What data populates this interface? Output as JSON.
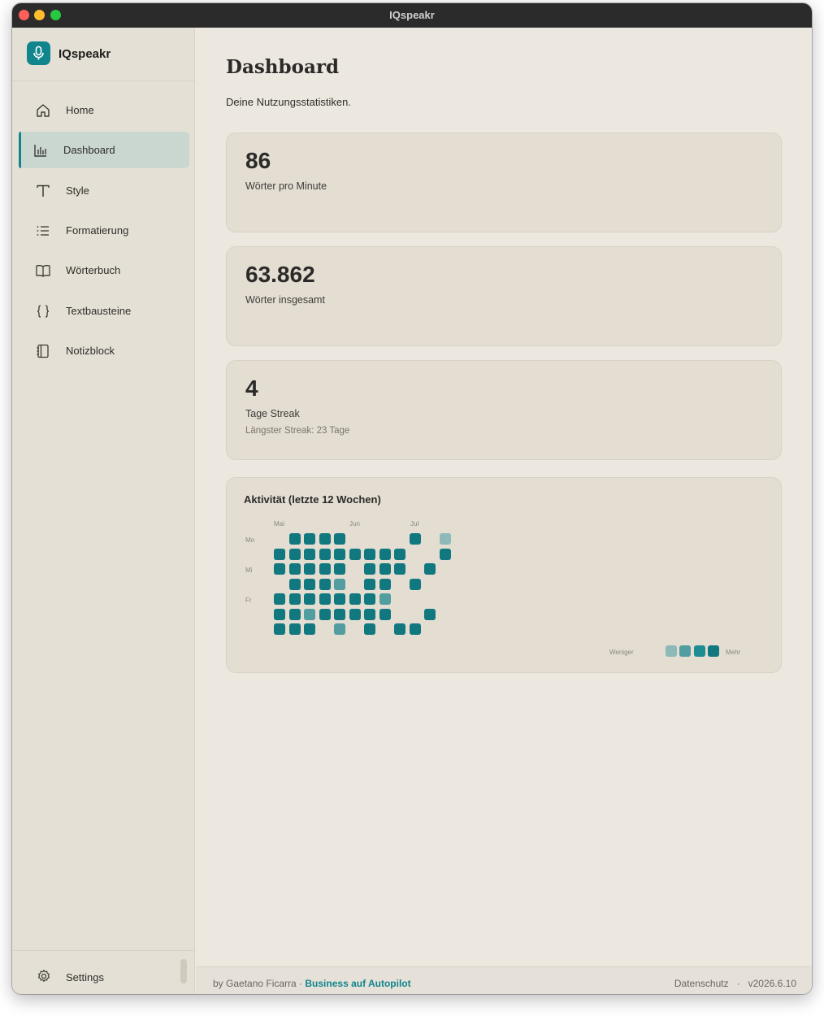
{
  "window": {
    "title": "IQspeakr"
  },
  "sidebar": {
    "brand": "IQspeakr",
    "items": [
      {
        "label": "Home",
        "icon": "home-icon"
      },
      {
        "label": "Dashboard",
        "icon": "bar-chart-icon",
        "active": true
      },
      {
        "label": "Style",
        "icon": "text-style-icon"
      },
      {
        "label": "Formatierung",
        "icon": "list-icon"
      },
      {
        "label": "Wörterbuch",
        "icon": "book-icon"
      },
      {
        "label": "Textbausteine",
        "icon": "braces-icon"
      },
      {
        "label": "Notizblock",
        "icon": "notebook-icon"
      }
    ],
    "settings_label": "Settings"
  },
  "main": {
    "title": "Dashboard",
    "subtitle": "Deine Nutzungsstatistiken.",
    "stats": [
      {
        "value": "86",
        "label": "Wörter pro Minute"
      },
      {
        "value": "63.862",
        "label": "Wörter insgesamt"
      },
      {
        "value": "4",
        "label": "Tage Streak",
        "sub": "Längster Streak: 23 Tage"
      }
    ],
    "activity": {
      "title": "Aktivität (letzte 12 Wochen)",
      "months": [
        "Mai",
        "Jun",
        "Jul"
      ],
      "day_labels": [
        "Mo",
        "Mi",
        "Fr"
      ],
      "legend_less": "Weniger",
      "legend_more": "Mehr",
      "accent": "#10787e",
      "levels_by_week": [
        [
          0,
          4,
          4,
          0,
          4,
          4,
          4
        ],
        [
          4,
          4,
          4,
          4,
          4,
          4,
          4
        ],
        [
          4,
          4,
          4,
          4,
          4,
          2,
          4
        ],
        [
          4,
          4,
          4,
          4,
          4,
          4,
          0
        ],
        [
          4,
          4,
          4,
          2,
          4,
          4,
          2
        ],
        [
          0,
          4,
          0,
          0,
          4,
          4,
          0
        ],
        [
          0,
          4,
          4,
          4,
          4,
          4,
          4
        ],
        [
          0,
          4,
          4,
          4,
          2,
          4,
          0
        ],
        [
          0,
          4,
          4,
          0,
          0,
          0,
          4
        ],
        [
          4,
          0,
          0,
          4,
          0,
          0,
          4
        ],
        [
          0,
          0,
          4,
          0,
          0,
          4,
          0
        ],
        [
          1,
          4,
          0,
          0,
          0,
          0,
          0
        ]
      ]
    }
  },
  "footer": {
    "by_text": "by Gaetano Ficarra · ",
    "link_text": "Business auf Autopilot",
    "privacy": "Datenschutz",
    "separator": "·",
    "version": "v2026.6.10"
  }
}
